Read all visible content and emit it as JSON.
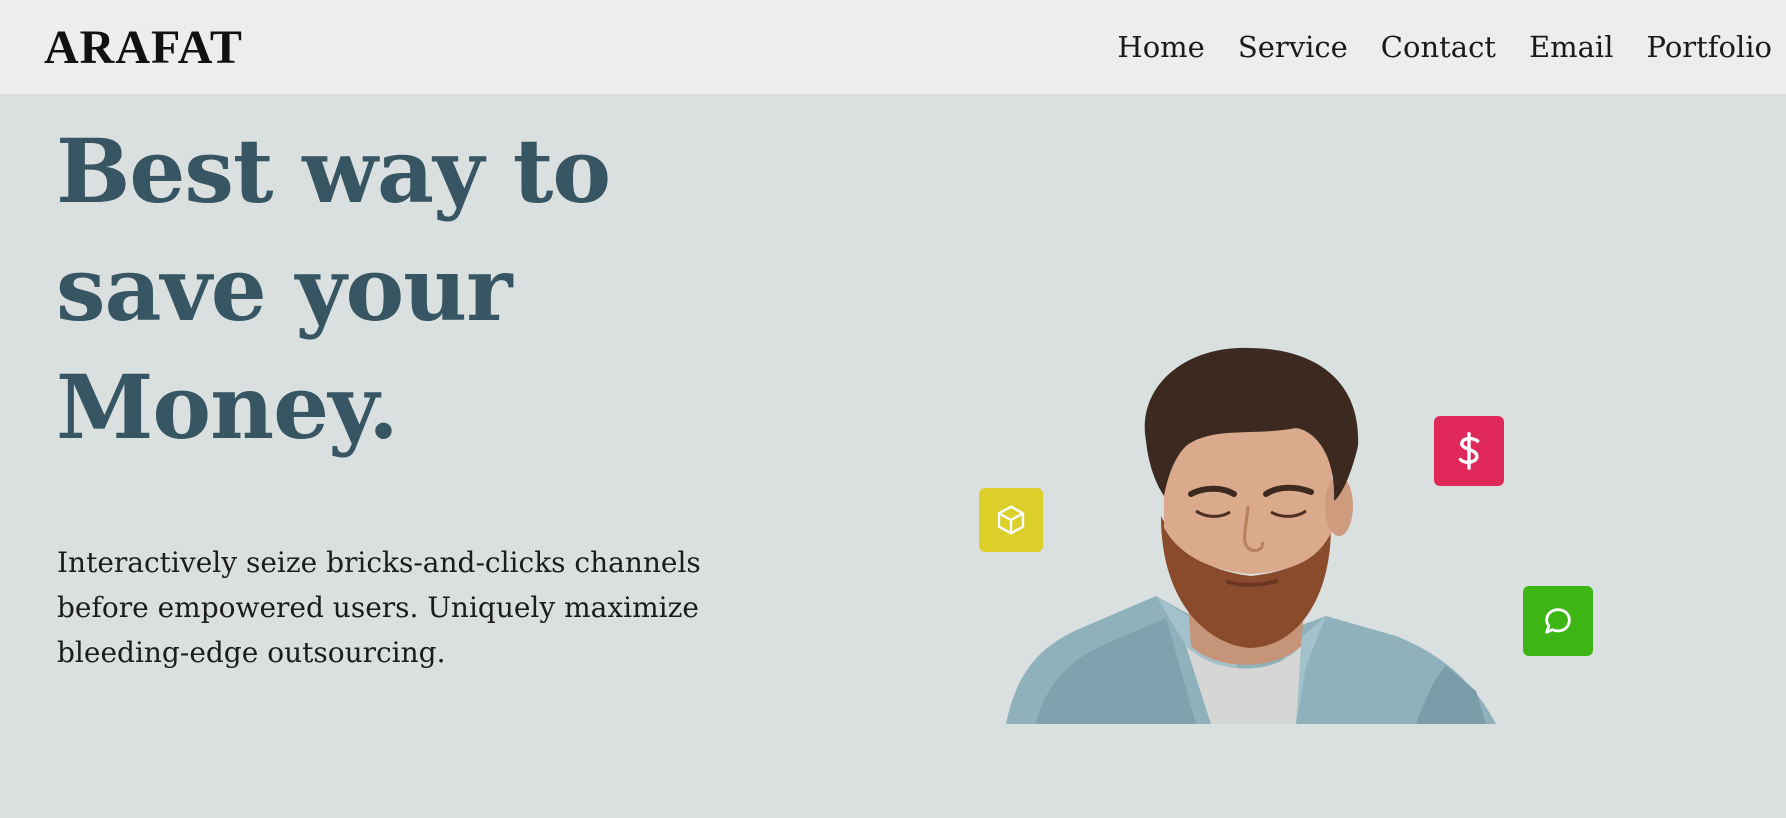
{
  "brand": {
    "logo": "ARAFAT"
  },
  "nav": {
    "items": [
      {
        "label": "Home"
      },
      {
        "label": "Service"
      },
      {
        "label": "Contact"
      },
      {
        "label": "Email"
      },
      {
        "label": "Portfolio"
      }
    ]
  },
  "hero": {
    "headline_lines": [
      "Best way to",
      "save your",
      "Money."
    ],
    "subtext": "Interactively seize bricks-and-clicks channels before empowered users. Uniquely maximize bleeding-edge outsourcing."
  },
  "badges": [
    {
      "icon": "box-icon",
      "color": "#dccf2a"
    },
    {
      "icon": "dollar-icon",
      "color": "#e0285a"
    },
    {
      "icon": "chat-icon",
      "color": "#3cb515"
    }
  ],
  "colors": {
    "page_bg": "#dadfe0",
    "navbar_bg": "#eeecec",
    "headline": "#375562"
  }
}
